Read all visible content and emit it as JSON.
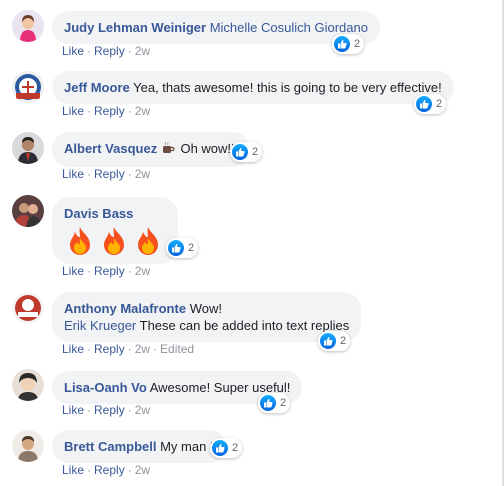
{
  "comments": [
    {
      "author": "Judy Lehman Weiniger",
      "mention": "Michelle Cosulich Giordano",
      "text": "",
      "reactions": "2",
      "actions": {
        "like": "Like",
        "reply": "Reply",
        "time": "2w"
      },
      "avatar_color": "#e8307a"
    },
    {
      "author": "Jeff Moore",
      "text": "Yea, thats awesome! this is going to be very effective!",
      "reactions": "2",
      "actions": {
        "like": "Like",
        "reply": "Reply",
        "time": "2w"
      },
      "avatar_color": "#2b5aa0"
    },
    {
      "author": "Albert Vasquez",
      "emoji": "coffee-icon",
      "text": "Oh wow!!!",
      "reactions": "2",
      "actions": {
        "like": "Like",
        "reply": "Reply",
        "time": "2w"
      },
      "avatar_color": "#4a3a34"
    },
    {
      "author": "Davis Bass",
      "emoji": "fire-icon x3",
      "text": "",
      "reactions": "2",
      "actions": {
        "like": "Like",
        "reply": "Reply",
        "time": "2w"
      },
      "avatar_color": "#b0403a"
    },
    {
      "author": "Anthony Malafronte",
      "text": "Wow!",
      "mention": "Erik Krueger",
      "text2": "These can be added into text replies",
      "reactions": "2",
      "actions": {
        "like": "Like",
        "reply": "Reply",
        "time": "2w",
        "edited": "Edited"
      },
      "avatar_color": "#c0392b"
    },
    {
      "author": "Lisa-Oanh Vo",
      "text": "Awesome! Super useful!",
      "reactions": "2",
      "actions": {
        "like": "Like",
        "reply": "Reply",
        "time": "2w"
      },
      "avatar_color": "#d8b8a0"
    },
    {
      "author": "Brett Campbell",
      "text": "My man !",
      "reactions": "2",
      "actions": {
        "like": "Like",
        "reply": "Reply",
        "time": "2w"
      },
      "avatar_color": "#8a7868"
    }
  ],
  "colors": {
    "link": "#385898",
    "bubble": "#f2f3f5",
    "like_blue": "#1877f2",
    "meta": "#90949c"
  }
}
